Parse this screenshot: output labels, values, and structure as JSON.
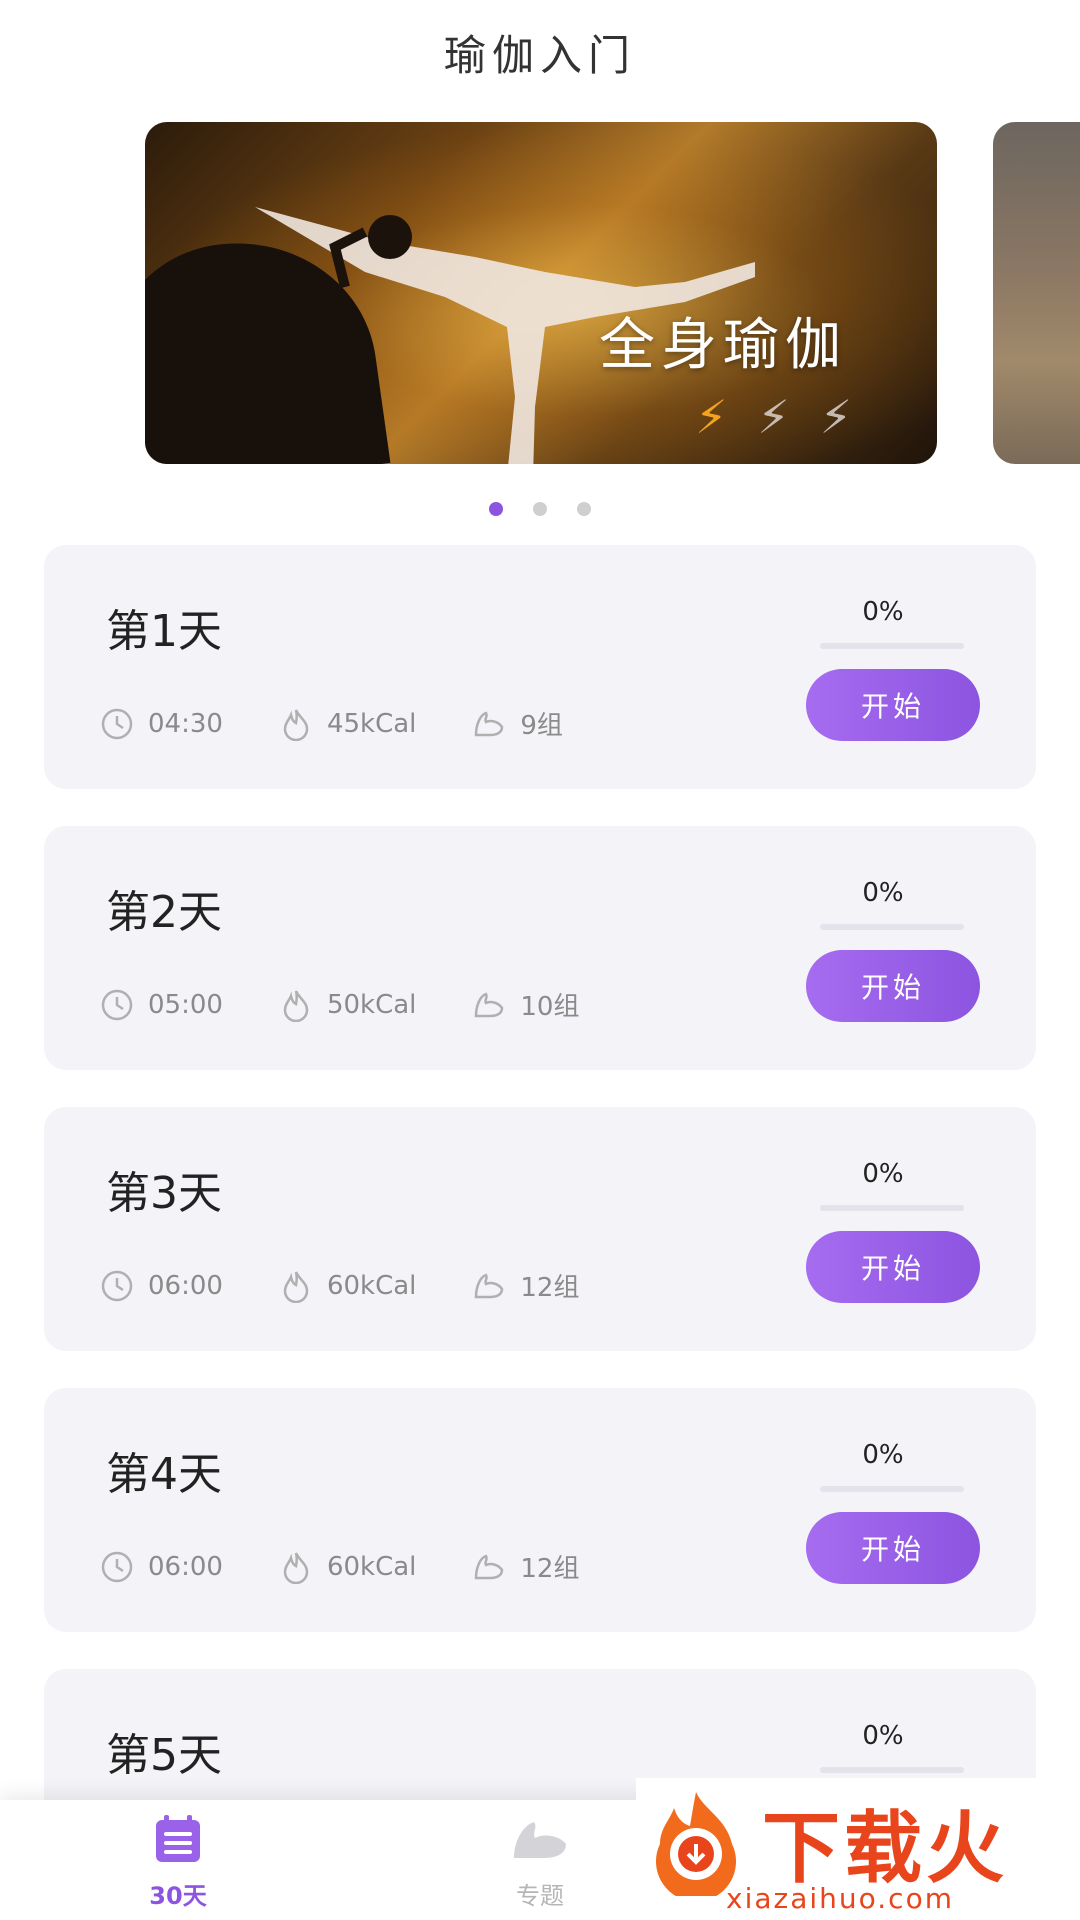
{
  "page": {
    "title": "瑜伽入门"
  },
  "banner": {
    "title": "全身瑜伽",
    "difficulty_level": 1,
    "difficulty_max": 3,
    "pages": 3,
    "active_page": 0
  },
  "days": [
    {
      "title": "第1天",
      "duration": "04:30",
      "calories": "45kCal",
      "sets": "9组",
      "percent_label": "0%",
      "progress": 0,
      "button": "开始"
    },
    {
      "title": "第2天",
      "duration": "05:00",
      "calories": "50kCal",
      "sets": "10组",
      "percent_label": "0%",
      "progress": 0,
      "button": "开始"
    },
    {
      "title": "第3天",
      "duration": "06:00",
      "calories": "60kCal",
      "sets": "12组",
      "percent_label": "0%",
      "progress": 0,
      "button": "开始"
    },
    {
      "title": "第4天",
      "duration": "06:00",
      "calories": "60kCal",
      "sets": "12组",
      "percent_label": "0%",
      "progress": 0,
      "button": "开始"
    },
    {
      "title": "第5天",
      "percent_label": "0%",
      "progress": 0
    }
  ],
  "nav": {
    "items": [
      {
        "label": "30天",
        "icon": "calendar-list-icon",
        "active": true
      },
      {
        "label": "专题",
        "icon": "muscle-icon",
        "active": false
      }
    ]
  },
  "watermark": {
    "brand": "下载火",
    "url": "xiazaihuo.com"
  },
  "colors": {
    "accent": "#8c54e0",
    "card_bg": "#f4f3f8",
    "bolt_active": "#f3a31d",
    "watermark": "#e8451c"
  }
}
